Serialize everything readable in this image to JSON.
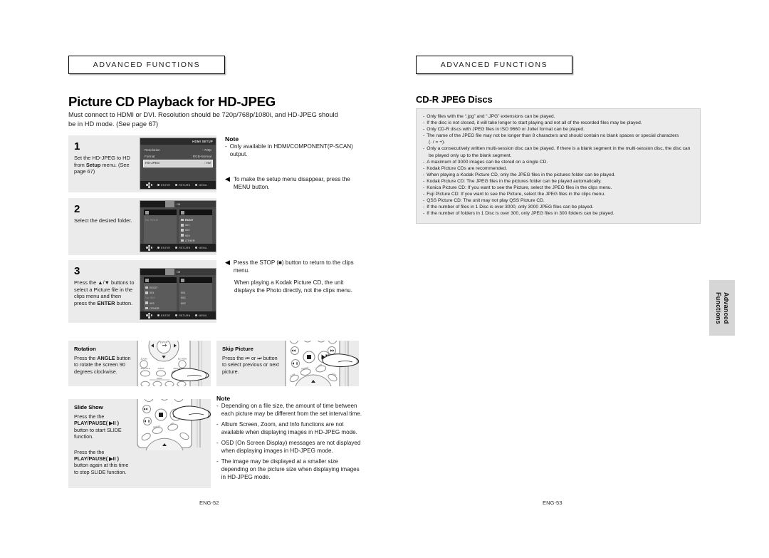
{
  "document": {
    "left_page": {
      "section_header": "Advanced Functions",
      "title": "Picture CD Playback for HD-JPEG",
      "intro": "Must connect to HDMI or DVI. Resolution should be 720p/768p/1080i, and HD-JPEG should be in HD mode. (See page 67)",
      "folio": "ENG-52",
      "steps": [
        {
          "number": "1",
          "text_before_bold": "Set the HD-JPEG to HD from ",
          "bold": "Setup",
          "text_after_bold": " menu. (See page 67)"
        },
        {
          "number": "2",
          "text_before_bold": "Select the desired folder.",
          "bold": "",
          "text_after_bold": ""
        },
        {
          "number": "3",
          "text_before_bold": "Press the ▲/▼ buttons to select a Picture file in the clips menu and then press the ",
          "bold": "ENTER",
          "text_after_bold": " button."
        }
      ],
      "screens": {
        "step1": {
          "title": "HDMI SETUP",
          "rows": [
            {
              "label": "Resolution",
              "value": ": 720p",
              "selected": false
            },
            {
              "label": "Format",
              "value": ": RGB-Normal",
              "selected": false
            },
            {
              "label": "HD-JPEG",
              "value": ": HD",
              "selected": true
            }
          ],
          "bottom_bar": [
            "ENTER",
            "RETURN",
            "MENU"
          ]
        },
        "step2": {
          "top_label": "Off",
          "left_items": [
            "No. ROOT"
          ],
          "right_items": [
            "ROOT",
            "001",
            "002",
            "003",
            "OTHER"
          ],
          "bottom_bar": [
            "ENTER",
            "RETURN",
            "MENU"
          ]
        },
        "step3": {
          "top_label": "Off",
          "left_items": [
            "ROOT",
            "001",
            "No. 002",
            "003",
            "OTHER"
          ],
          "right_items": [
            ". .",
            "001",
            "002",
            "003"
          ],
          "bottom_bar": [
            "ENTER",
            "RETURN",
            "MENU"
          ]
        }
      },
      "notes_top": {
        "heading": "Note",
        "items": [
          "Only available in HDMI/COMPONENT(P-SCAN) output."
        ]
      },
      "arrow_notes": [
        "To make the setup menu disappear, press the MENU button.",
        "Press the STOP (■) button to return to the clips menu."
      ],
      "arrow_note_followup": "When playing a Kodak Picture CD, the unit displays the Photo directly, not the clips menu.",
      "features": [
        {
          "title": "Rotation",
          "before": "Press the ",
          "bold": "ANGLE",
          "after": " button to rotate the screen 90 degrees clockwise.",
          "remote": "remote-upper-keys"
        },
        {
          "title": "Skip Picture",
          "before": "Press the ⏮ or ⏭ button to select previous or next picture.",
          "bold": "",
          "after": "",
          "remote": "remote-transport-keys"
        },
        {
          "title": "Slide Show",
          "before": "Press the the ",
          "bold": "PLAY/PAUSE( ▶II )",
          "after": " button to start SLIDE function.",
          "remote": "remote-transport-keys"
        }
      ],
      "slide_show_second": {
        "before": "Press the the ",
        "bold": "PLAY/PAUSE( ▶II )",
        "after": " button again at this time to stop SLIDE function."
      },
      "notes_bottom": {
        "heading": "Note",
        "items": [
          "Depending on a file size, the amount of time between each picture may be different from the set interval time.",
          "Album Screen, Zoom, and Info functions are not available when displaying images in HD-JPEG mode.",
          "OSD (On Screen Display) messages are not displayed when displaying images in HD-JPEG mode.",
          "The image may be displayed at a smaller size depending on the picture size when displaying images in HD-JPEG mode."
        ]
      }
    },
    "right_page": {
      "section_header": "Advanced Functions",
      "title": "CD-R JPEG Discs",
      "folio": "ENG-53",
      "spec_items": [
        "Only files with the “.jpg” and “.JPG” extensions can be played.",
        "If the disc is not closed, it will take longer to start playing and not all of the recorded files may be played.",
        "Only CD-R discs with JPEG files in ISO 9660 or Joliet format can be played.",
        "The name of the JPEG file may not be longer than 8 characters and should contain no blank spaces or special characters",
        "Only a consecutively written multi-session disc can be played. If there is a blank segment in the multi-session disc, the disc can",
        "A maximum of 3000 images can be stored on a single CD.",
        "Kodak Picture CDs are recommended.",
        "When playing a Kodak Picture CD, only the JPEG files in the pictures folder can be played.",
        "Kodak Picture CD: The JPEG files in the pictures folder can be played automatically.",
        "Konica Picture CD: If you want to see the Picture, select the JPEG files in the clips menu.",
        "Fuji Picture CD: If you want to see the Picture, select the JPEG files in the clips menu.",
        "QSS Picture CD: The unit may not play QSS Picture CD.",
        "If the number of files in 1 Disc is over 3000, only 3000 JPEG files can be played.",
        "If the number of folders in 1 Disc is over 300, only JPEG files in 300 folders can be played."
      ],
      "spec_continuations": {
        "after_item_4": "(. / = +).",
        "after_item_5": "be played only up to the blank segment."
      }
    },
    "thumb_tab": {
      "line1": "Advanced",
      "line2": "Functions"
    }
  }
}
